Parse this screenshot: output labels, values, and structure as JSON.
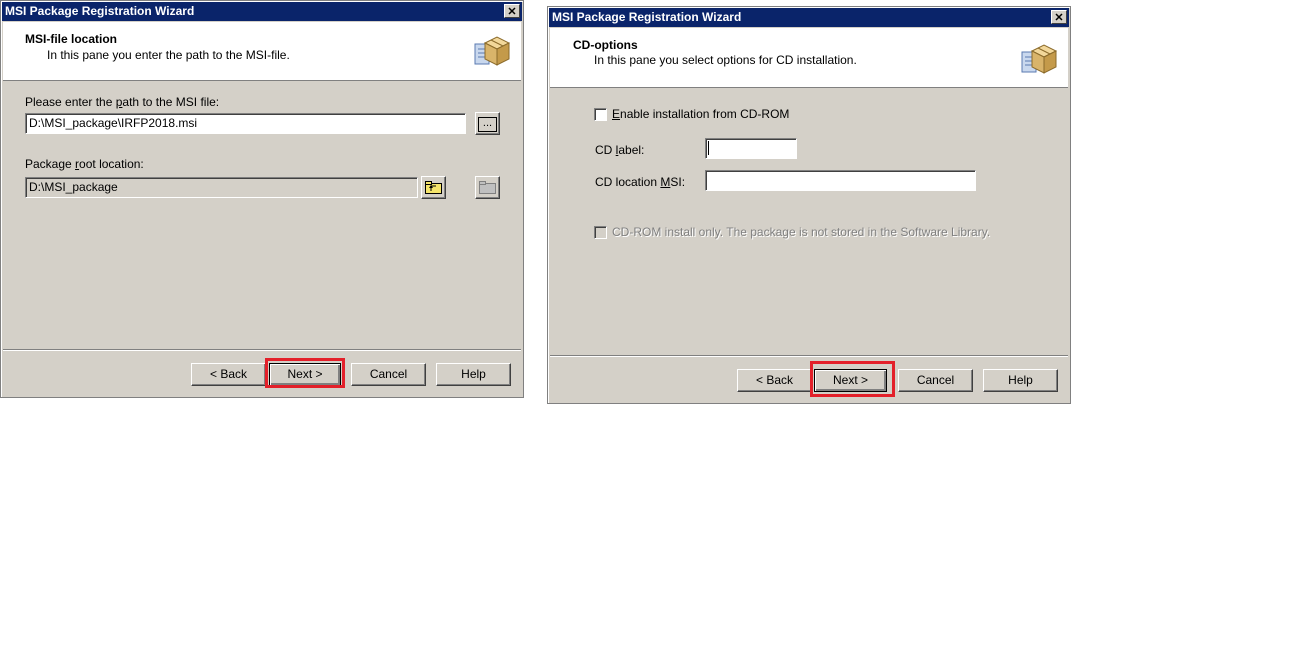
{
  "dialog1": {
    "title": "MSI Package Registration Wizard",
    "close_glyph": "✕",
    "header_title": "MSI-file location",
    "header_subtitle": "In this pane you enter the path to the MSI-file.",
    "msi_path_label": "Please enter the path to the MSI file:",
    "msi_path_value": "D:\\MSI_package\\IRFP2018.msi",
    "browse_label": "...",
    "root_label": "Package root location:",
    "root_value": "D:\\MSI_package",
    "buttons": {
      "back": "< Back",
      "next": "Next >",
      "cancel": "Cancel",
      "help": "Help"
    },
    "icons": [
      "package-icon",
      "folder-up-icon",
      "folder-icon"
    ]
  },
  "dialog2": {
    "title": "MSI Package Registration Wizard",
    "close_glyph": "✕",
    "header_title": "CD-options",
    "header_subtitle": "In this pane you select options for CD installation.",
    "enable_cd_label": "Enable installation from CD-ROM",
    "cd_label_label": "CD label:",
    "cd_label_value": "",
    "cd_location_label": "CD location MSI:",
    "cd_location_value": "",
    "cd_only_label": "CD-ROM install only. The package is not stored in the Software Library.",
    "buttons": {
      "back": "< Back",
      "next": "Next >",
      "cancel": "Cancel",
      "help": "Help"
    },
    "icons": [
      "package-icon"
    ]
  },
  "colors": {
    "highlight": "#e3202a",
    "titlebar": "#0a246a",
    "dialog_bg": "#d4d0c8"
  }
}
